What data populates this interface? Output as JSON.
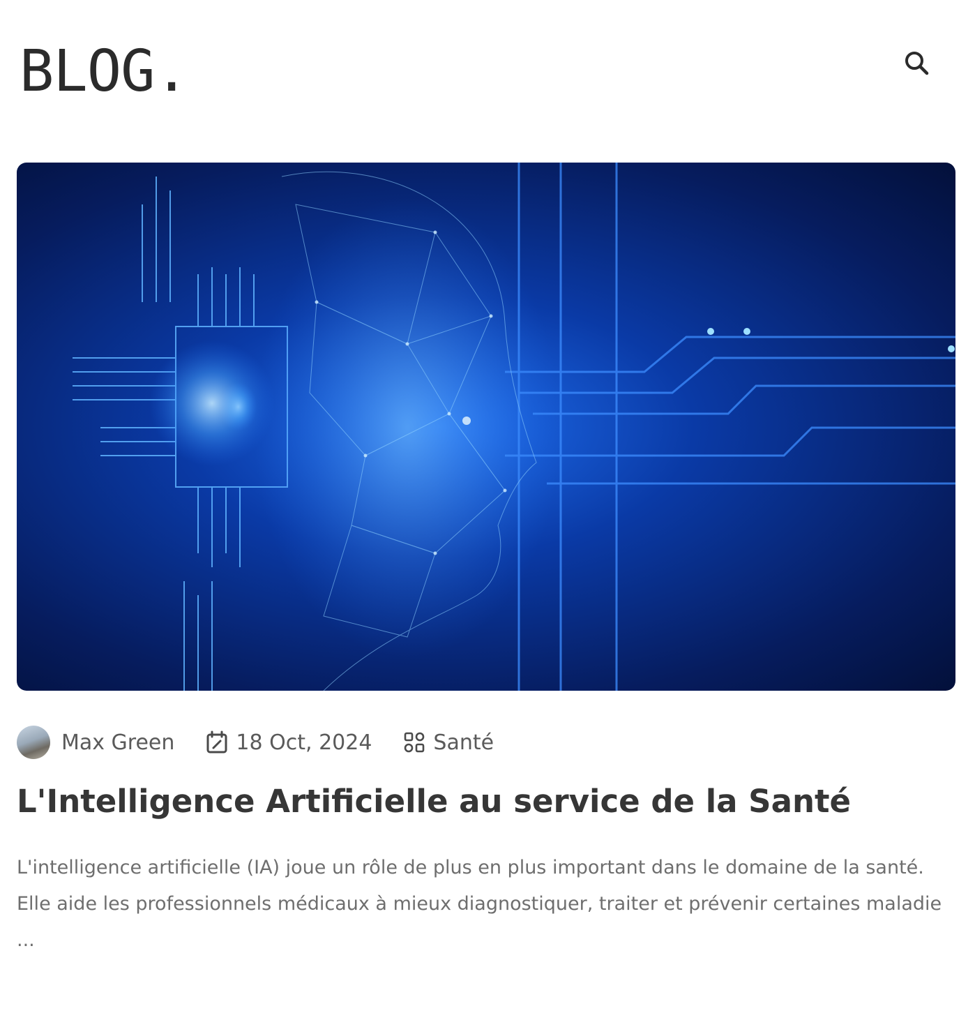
{
  "header": {
    "logo": "BLOG.",
    "search_icon": "search-icon"
  },
  "post": {
    "image_alt": "AI head with circuit board",
    "author": "Max Green",
    "date": "18 Oct, 2024",
    "category": "Santé",
    "title": "L'Intelligence Artificielle au service de la Santé",
    "excerpt": "L'intelligence artificielle (IA) joue un rôle de plus en plus important dans le domaine de la santé. Elle aide les professionnels médicaux à mieux diagnostiquer, traiter et prévenir certaines maladie ..."
  },
  "icons": {
    "date": "calendar-edit-icon",
    "category": "category-grid-icon"
  },
  "colors": {
    "text": "#363636",
    "muted": "#6e6e6e",
    "hero_primary": "#1f6ff0",
    "hero_dark": "#03103a"
  }
}
